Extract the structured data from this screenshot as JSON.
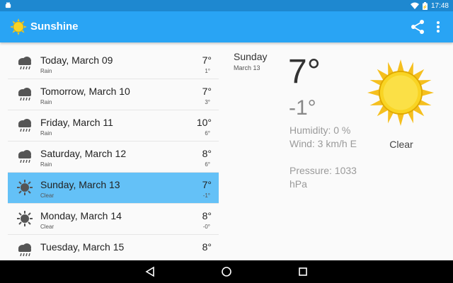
{
  "status_bar": {
    "time": "17:48"
  },
  "app": {
    "title": "Sunshine"
  },
  "forecast": [
    {
      "date": "Today, March 09",
      "description": "Rain",
      "high": "7°",
      "low": "1°",
      "icon": "rain-icon"
    },
    {
      "date": "Tomorrow, March 10",
      "description": "Rain",
      "high": "7°",
      "low": "3°",
      "icon": "rain-icon"
    },
    {
      "date": "Friday, March 11",
      "description": "Rain",
      "high": "10°",
      "low": "6°",
      "icon": "rain-icon"
    },
    {
      "date": "Saturday, March 12",
      "description": "Rain",
      "high": "8°",
      "low": "6°",
      "icon": "rain-icon"
    },
    {
      "date": "Sunday, March 13",
      "description": "Clear",
      "high": "7°",
      "low": "-1°",
      "icon": "sun-icon"
    },
    {
      "date": "Monday, March 14",
      "description": "Clear",
      "high": "8°",
      "low": "-0°",
      "icon": "sun-icon"
    },
    {
      "date": "Tuesday, March 15",
      "description": "",
      "high": "8°",
      "low": "",
      "icon": "rain-icon"
    }
  ],
  "selected_index": 4,
  "detail": {
    "day": "Sunday",
    "date": "March 13",
    "high": "7°",
    "low": "-1°",
    "humidity": "Humidity: 0 %",
    "wind": "Wind: 3 km/h E",
    "pressure": "Pressure: 1033 hPa",
    "condition": "Clear",
    "icon": "sun-icon"
  },
  "colors": {
    "status_bar": "#1e88d0",
    "app_bar": "#29a4f4",
    "selected_row": "#64c1f7",
    "sun": "#f9d423"
  }
}
